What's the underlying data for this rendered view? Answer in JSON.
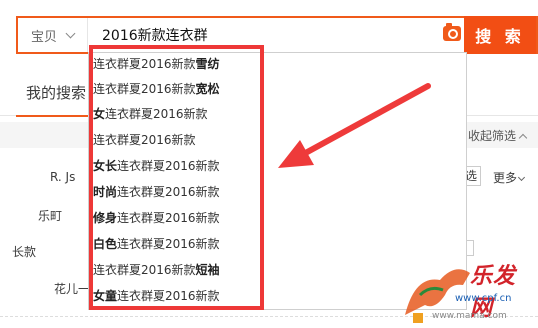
{
  "search": {
    "scope_label": "宝贝",
    "query": "2016新款连衣群",
    "button_label": "搜 索"
  },
  "page": {
    "my_search_label": "我的搜索",
    "collapse_filter_label": "收起筛选",
    "multi_select_label": "选",
    "more_label": "更多",
    "brand_r": "R. Js",
    "brand_lemon": "乐町",
    "long_style": "长款",
    "flower": "花儿一"
  },
  "suggestions": [
    {
      "pre": "",
      "mid": "连衣群夏2016新款",
      "post": "雪纺"
    },
    {
      "pre": "",
      "mid": "连衣群夏2016新款",
      "post": "宽松"
    },
    {
      "pre": "女",
      "mid": "连衣群夏2016新款",
      "post": ""
    },
    {
      "pre": "",
      "mid": "连衣群夏2016新款",
      "post": ""
    },
    {
      "pre": "女长",
      "mid": "连衣群夏2016新款",
      "post": ""
    },
    {
      "pre": "时尚",
      "mid": "连衣群夏2016新款",
      "post": ""
    },
    {
      "pre": "修身",
      "mid": "连衣群夏2016新款",
      "post": ""
    },
    {
      "pre": "白色",
      "mid": "连衣群夏2016新款",
      "post": ""
    },
    {
      "pre": "",
      "mid": "连衣群夏2016新款",
      "post": "短袖"
    },
    {
      "pre": "女童",
      "mid": "连衣群夏2016新款",
      "post": ""
    }
  ],
  "watermark": {
    "brand": "乐发网",
    "url": "www.cpf.cn",
    "url2": "www.mama.com"
  },
  "colors": {
    "accent": "#f05a1a",
    "highlight": "#ee3837"
  }
}
